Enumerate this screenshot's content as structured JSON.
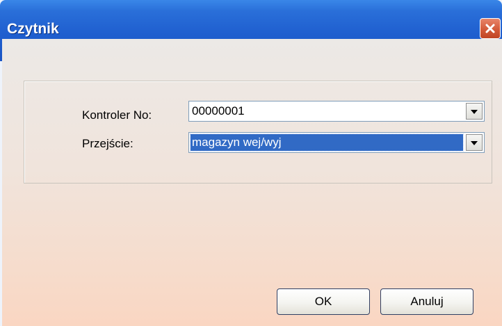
{
  "window": {
    "title": "Czytnik"
  },
  "form": {
    "controller": {
      "label": "Kontroler No:",
      "value": "00000001"
    },
    "passage": {
      "label": "Przejście:",
      "value": "magazyn wej/wyj"
    }
  },
  "buttons": {
    "ok_label": "OK",
    "cancel_label": "Anuluj"
  },
  "colors": {
    "titlebar": "#1f5fcf",
    "close_button": "#d35a3a",
    "selection": "#316ac5"
  },
  "icons": {
    "close": "close-icon",
    "dropdown": "chevron-down-icon"
  }
}
